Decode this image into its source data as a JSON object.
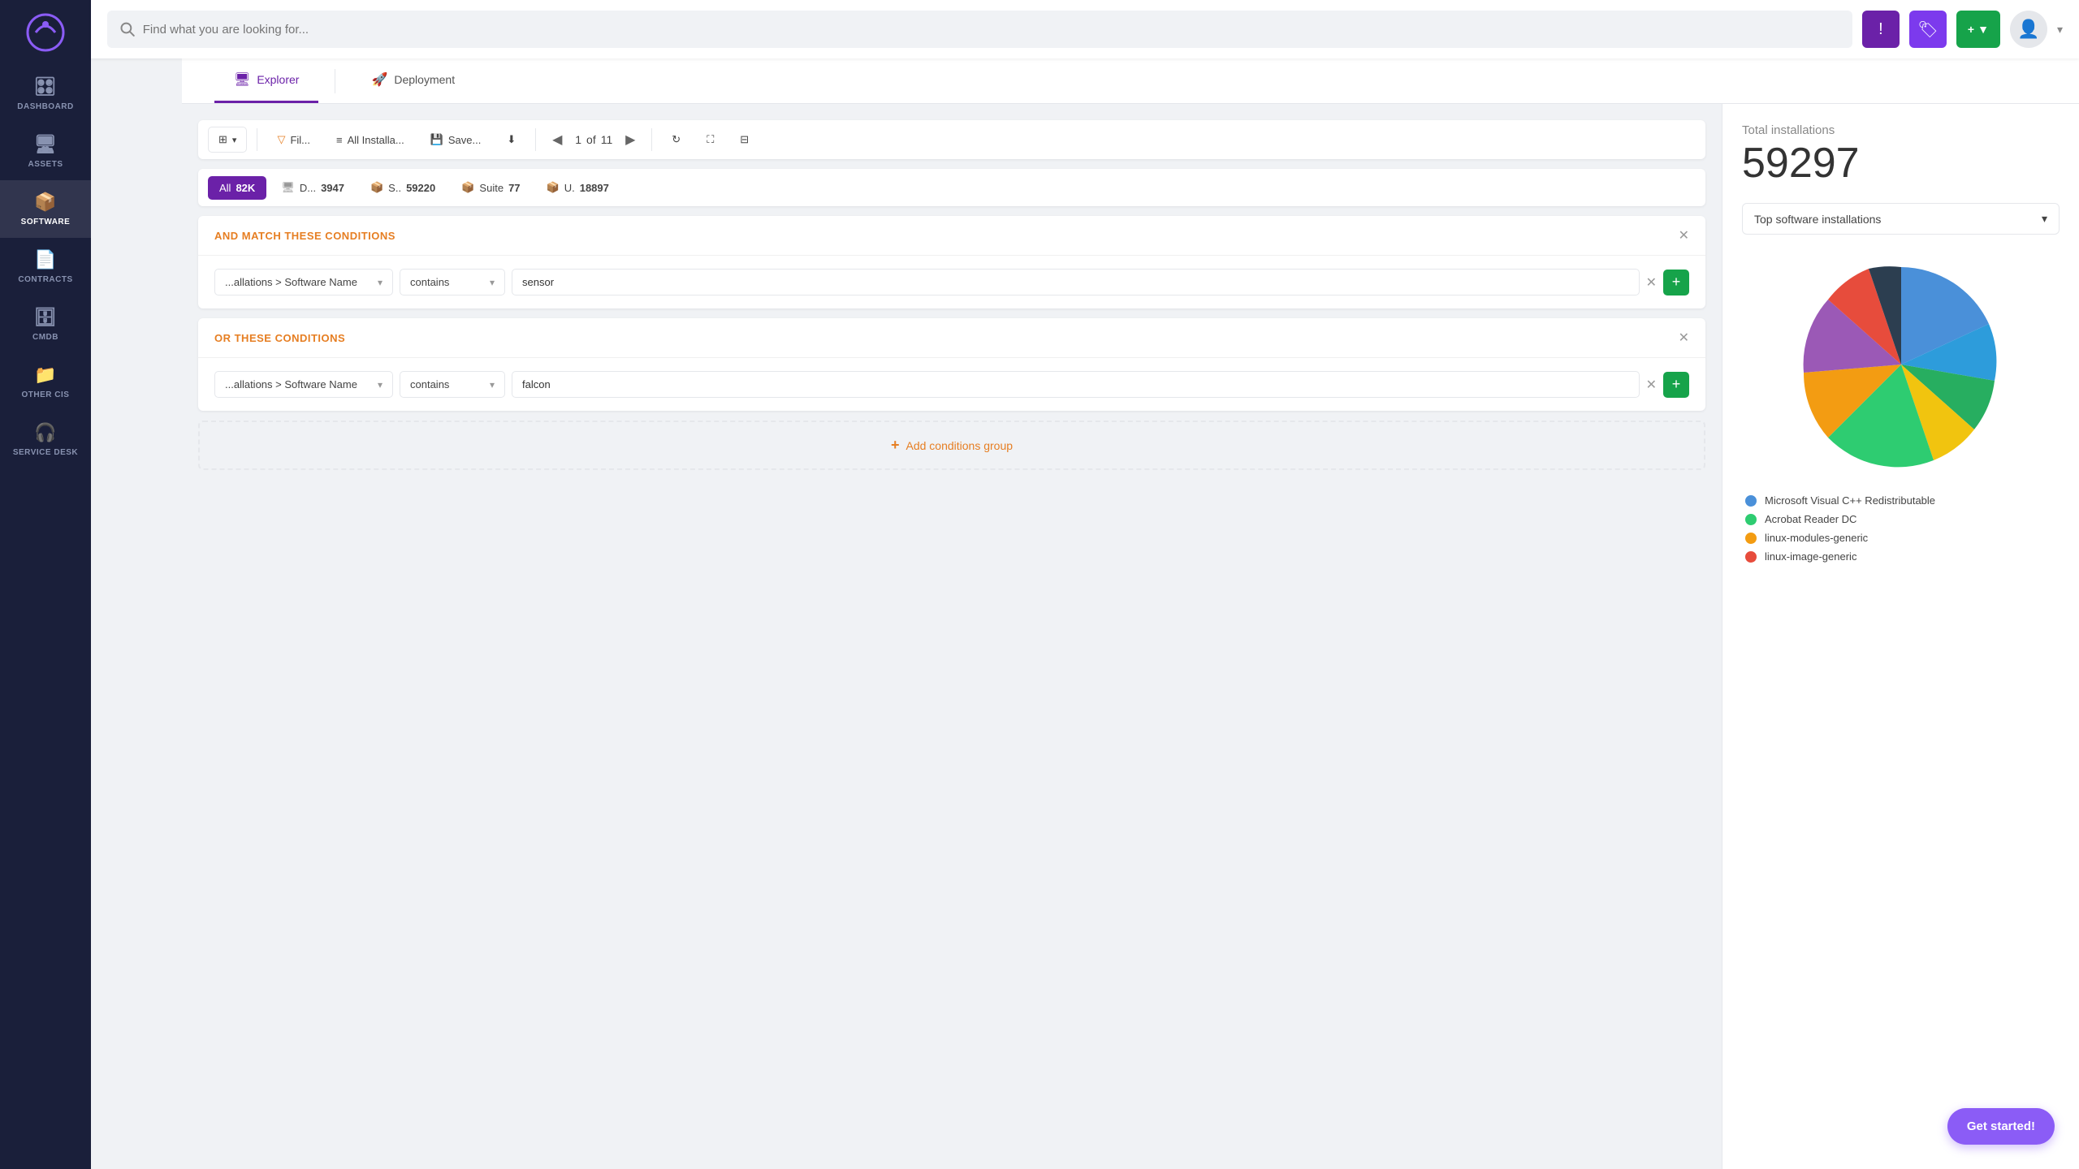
{
  "sidebar": {
    "items": [
      {
        "id": "dashboard",
        "label": "DASHBOARD",
        "icon": "🎛",
        "active": false
      },
      {
        "id": "assets",
        "label": "ASSETS",
        "icon": "🖥",
        "active": false
      },
      {
        "id": "software",
        "label": "SOFTWARE",
        "icon": "📦",
        "active": true
      },
      {
        "id": "contracts",
        "label": "CONTRACTS",
        "icon": "📄",
        "active": false
      },
      {
        "id": "cmdb",
        "label": "CMDB",
        "icon": "🗄",
        "active": false
      },
      {
        "id": "other-cis",
        "label": "OTHER CIs",
        "icon": "📁",
        "active": false
      },
      {
        "id": "service-desk",
        "label": "SERVICE DESK",
        "icon": "🎧",
        "active": false
      }
    ]
  },
  "topbar": {
    "search_placeholder": "Find what you are looking for...",
    "bell_label": "!",
    "tag_label": "🏷",
    "add_label": "+ ▼",
    "avatar_label": "👤"
  },
  "tabs": [
    {
      "id": "explorer",
      "label": "Explorer",
      "icon": "🖥",
      "active": true
    },
    {
      "id": "deployment",
      "label": "Deployment",
      "icon": "🚀",
      "active": false
    }
  ],
  "toolbar": {
    "view_btn": "⊞",
    "filter_label": "Fil...",
    "layers_label": "All Installa...",
    "save_label": "Save...",
    "download_label": "⬇",
    "page_current": "1",
    "page_total": "11",
    "of_label": "of",
    "refresh_label": "↻",
    "expand_label": "⛶",
    "grid_label": "⊟"
  },
  "filter_tabs": [
    {
      "id": "all",
      "label": "All",
      "count": "82K",
      "icon": null,
      "active": true
    },
    {
      "id": "d",
      "label": "D...",
      "count": "3947",
      "icon": "🖥",
      "active": false
    },
    {
      "id": "s",
      "label": "S..",
      "count": "59220",
      "icon": "📦",
      "active": false
    },
    {
      "id": "suite",
      "label": "Suite",
      "count": "77",
      "icon": "📦",
      "active": false
    },
    {
      "id": "u",
      "label": "U.",
      "count": "18897",
      "icon": "📦",
      "active": false
    }
  ],
  "conditions": {
    "and_title": "AND MATCH THESE CONDITIONS",
    "or_title": "OR THESE CONDITIONS",
    "field_label": "...allations > Software Name",
    "operator_label": "contains",
    "value1": "sensor",
    "value2": "falcon",
    "add_group_label": "Add conditions group"
  },
  "right_panel": {
    "total_label": "Total installations",
    "total_count": "59297",
    "chart_selector_label": "Top software installations",
    "legend": [
      {
        "id": "ms-visual-cpp",
        "label": "Microsoft Visual C++ Redistributable",
        "color": "#4a90d9"
      },
      {
        "id": "acrobat-reader",
        "label": "Acrobat Reader DC",
        "color": "#2ecc71"
      },
      {
        "id": "linux-modules",
        "label": "linux-modules-generic",
        "color": "#f39c12"
      },
      {
        "id": "linux-image",
        "label": "linux-image-generic",
        "color": "#e74c3c"
      }
    ]
  },
  "get_started": {
    "label": "Get started!"
  }
}
